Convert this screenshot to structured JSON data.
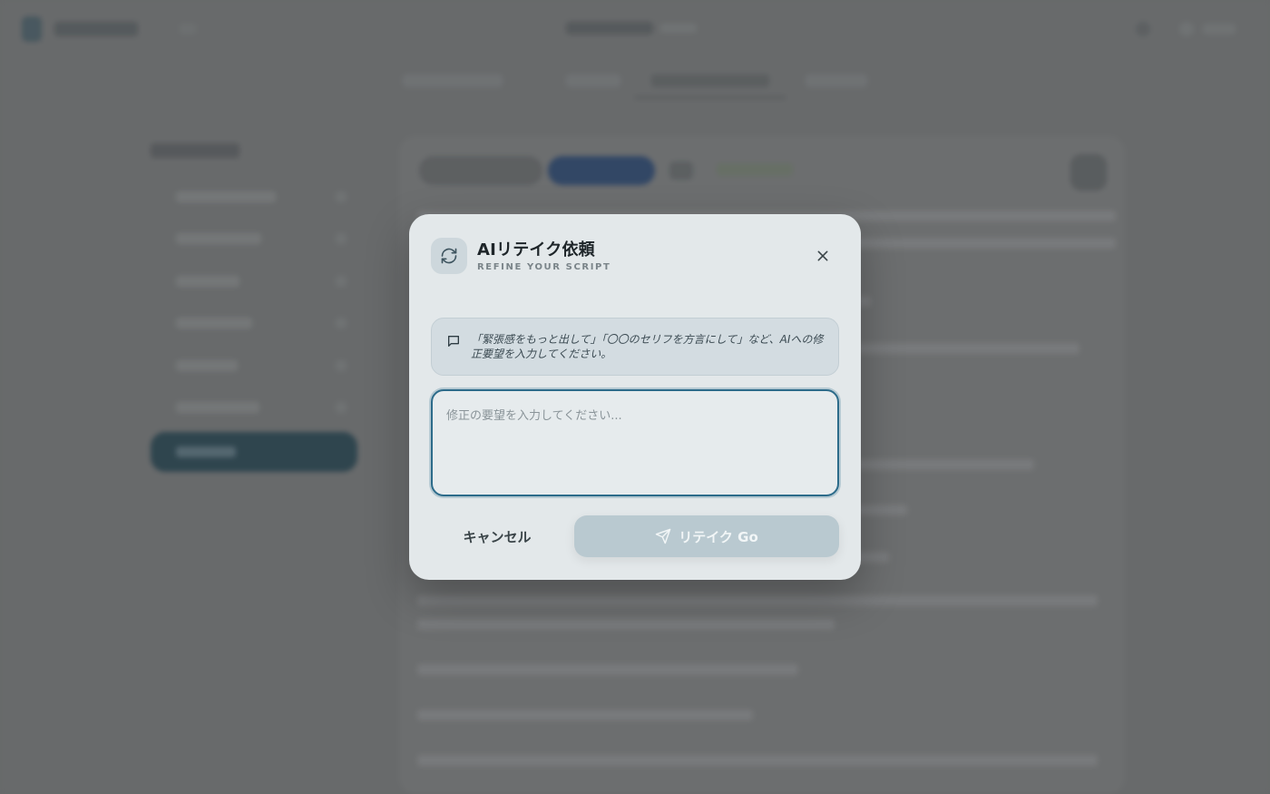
{
  "modal": {
    "title": "AIリテイク依頼",
    "subtitle": "REFINE YOUR SCRIPT",
    "icon": "refresh-icon",
    "close_icon": "close-icon",
    "hint": {
      "icon": "message-icon",
      "text": "「緊張感をもっと出して」「〇〇のセリフを方言にして」など、AIへの修正要望を入力してください。"
    },
    "input": {
      "value": "",
      "placeholder": "修正の要望を入力してください..."
    },
    "cancel_label": "キャンセル",
    "submit_label": "リテイク Go",
    "submit_icon": "send-icon"
  },
  "colors": {
    "modal_bg": "#e3e8ea",
    "accent": "#2c6b8a",
    "submit_bg": "#b9c9d0",
    "hint_bg": "#d3dce1"
  }
}
